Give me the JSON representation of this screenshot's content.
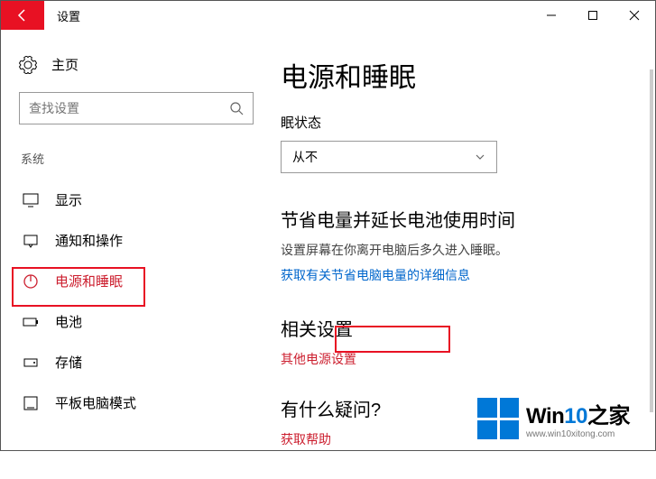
{
  "titlebar": {
    "title": "设置"
  },
  "sidebar": {
    "home": "主页",
    "search_placeholder": "查找设置",
    "section": "系统",
    "items": [
      {
        "label": "显示"
      },
      {
        "label": "通知和操作"
      },
      {
        "label": "电源和睡眠"
      },
      {
        "label": "电池"
      },
      {
        "label": "存储"
      },
      {
        "label": "平板电脑模式"
      }
    ]
  },
  "main": {
    "title": "电源和睡眠",
    "field_label": "眠状态",
    "dropdown_value": "从不",
    "section1_heading": "节省电量并延长电池使用时间",
    "section1_desc": "设置屏幕在你离开电脑后多久进入睡眠。",
    "section1_link": "获取有关节省电脑电量的详细信息",
    "section2_heading": "相关设置",
    "section2_link": "其他电源设置",
    "section3_heading": "有什么疑问?",
    "section3_link": "获取帮助"
  },
  "watermark": {
    "brand1": "Win",
    "brand2": "10",
    "brand3": "之家",
    "url": "www.win10xitong.com"
  }
}
